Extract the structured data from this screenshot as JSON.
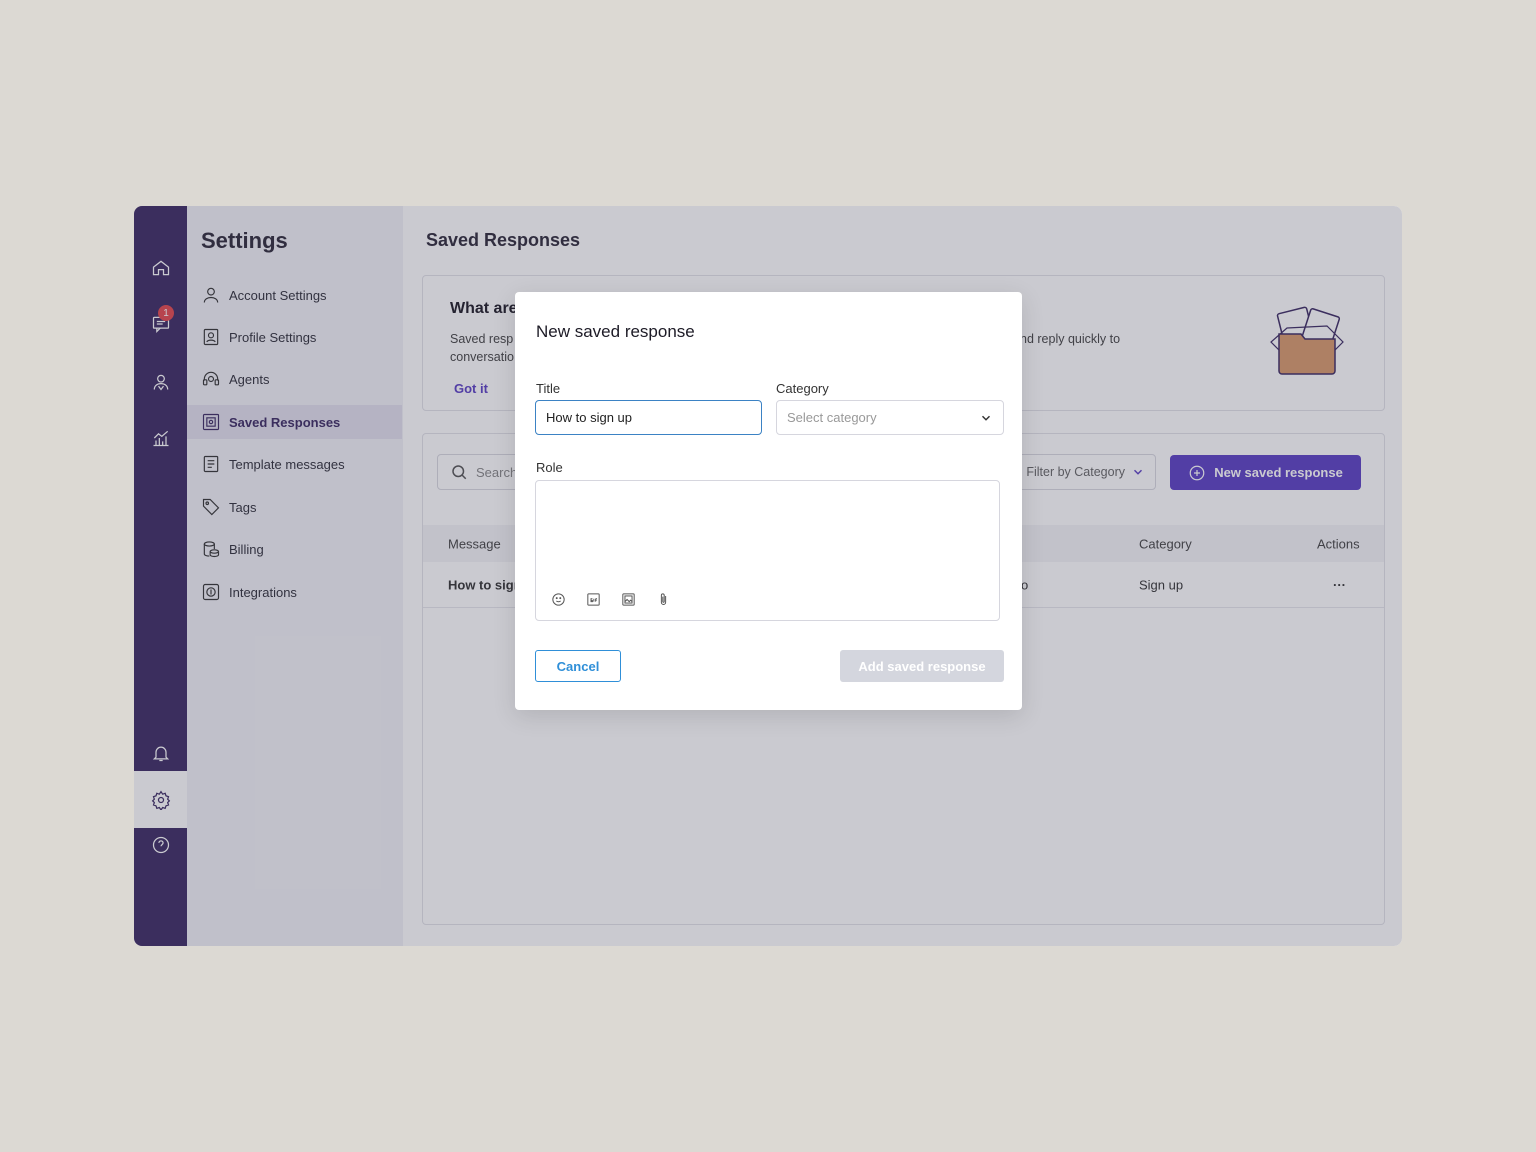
{
  "settings": {
    "title": "Settings"
  },
  "rail": {
    "notification_count": "1"
  },
  "nav": {
    "items": [
      {
        "label": "Account Settings"
      },
      {
        "label": "Profile Settings"
      },
      {
        "label": "Agents"
      },
      {
        "label": "Saved Responses"
      },
      {
        "label": "Template messages"
      },
      {
        "label": "Tags"
      },
      {
        "label": "Billing"
      },
      {
        "label": "Integrations"
      }
    ]
  },
  "main": {
    "title": "Saved Responses",
    "info": {
      "title": "What are",
      "text_line1_left": "Saved resp",
      "text_line1_right": "nd reply quickly to",
      "text_line2_left": "conversatio",
      "link": "Got it"
    },
    "search": {
      "placeholder": "Search"
    },
    "filter": {
      "label": "Filter by Category"
    },
    "new_button": "New saved response",
    "table": {
      "headers": {
        "message": "Message",
        "category": "Category",
        "actions": "Actions"
      },
      "rows": [
        {
          "message": "How to sign",
          "mid_fragment": "o",
          "category": "Sign up",
          "actions": "···"
        }
      ]
    }
  },
  "modal": {
    "title": "New saved response",
    "title_label": "Title",
    "title_value": "How to sign up",
    "category_label": "Category",
    "category_placeholder": "Select category",
    "role_label": "Role",
    "cancel": "Cancel",
    "submit": "Add saved response"
  },
  "colors": {
    "rail": "#3b2a63",
    "accent": "#5b3fc4",
    "focus": "#3b82c4",
    "badge": "#e5484d"
  }
}
